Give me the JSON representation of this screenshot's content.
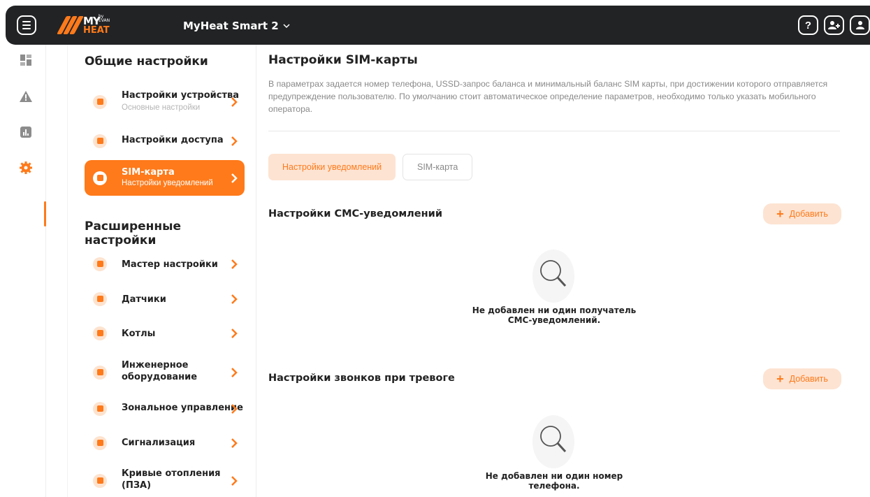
{
  "header": {
    "logo_my": "MY",
    "logo_heat": "HEAT",
    "logo_by": "by EVAN",
    "device_name": "MyHeat Smart 2",
    "device_chevron": "⌵",
    "help_label": "?",
    "add_user_label": "+"
  },
  "rail": {
    "items": [
      {
        "icon": "dashboard-icon"
      },
      {
        "icon": "warning-icon"
      },
      {
        "icon": "chart-icon"
      },
      {
        "icon": "gear-icon"
      }
    ]
  },
  "settings": {
    "general_title": "Общие настройки",
    "general_items": [
      {
        "title": "Настройки устройства",
        "subtitle": "Основные настройки",
        "icon": "device-settings-icon"
      },
      {
        "title": "Настройки доступа",
        "subtitle": "",
        "icon": "access-icon"
      },
      {
        "title": "SIM-карта",
        "subtitle": "Настройки уведомлений",
        "icon": "sim-card-icon",
        "active": true
      }
    ],
    "advanced_title": "Расширенные настройки",
    "advanced_items": [
      {
        "title": "Мастер настройки",
        "icon": "wizard-icon"
      },
      {
        "title": "Датчики",
        "icon": "sensor-icon"
      },
      {
        "title": "Котлы",
        "icon": "boiler-icon"
      },
      {
        "title": "Инженерное оборудование",
        "title_line1": "Инженерное",
        "title_line2": "оборудование",
        "icon": "engineering-icon"
      },
      {
        "title": "Зональное управление",
        "icon": "zone-icon"
      },
      {
        "title": "Сигнализация",
        "icon": "lock-icon"
      },
      {
        "title": "Кривые отопления (ПЗА)",
        "title_line1": "Кривые отопления",
        "title_line2": "(ПЗА)",
        "icon": "curve-icon"
      }
    ]
  },
  "main": {
    "title": "Настройки SIM-карты",
    "description": "В параметрах задается номер телефона, USSD-запрос баланса и минимальный баланс SIM карты, при достижении которого отправляется предупреждение пользователю. По умолчанию стоит автоматическое определение параметров, необходимо только указать мобильного оператора.",
    "tabs": [
      {
        "label": "Настройки уведомлений",
        "active": true
      },
      {
        "label": "SIM-карта",
        "active": false
      }
    ],
    "sms_section": {
      "title": "Настройки СМС-уведомлений",
      "add_label": "Добавить",
      "empty_line1": "Не добавлен ни один получатель",
      "empty_line2": "СМС-уведомлений."
    },
    "call_section": {
      "title": "Настройки звонков при тревоге",
      "add_label": "Добавить",
      "empty_line1": "Не добавлен ни один номер",
      "empty_line2": "телефона."
    }
  },
  "colors": {
    "accent": "#ff7a1a",
    "accent_light": "#fde3d2",
    "header_bg": "#222325"
  }
}
